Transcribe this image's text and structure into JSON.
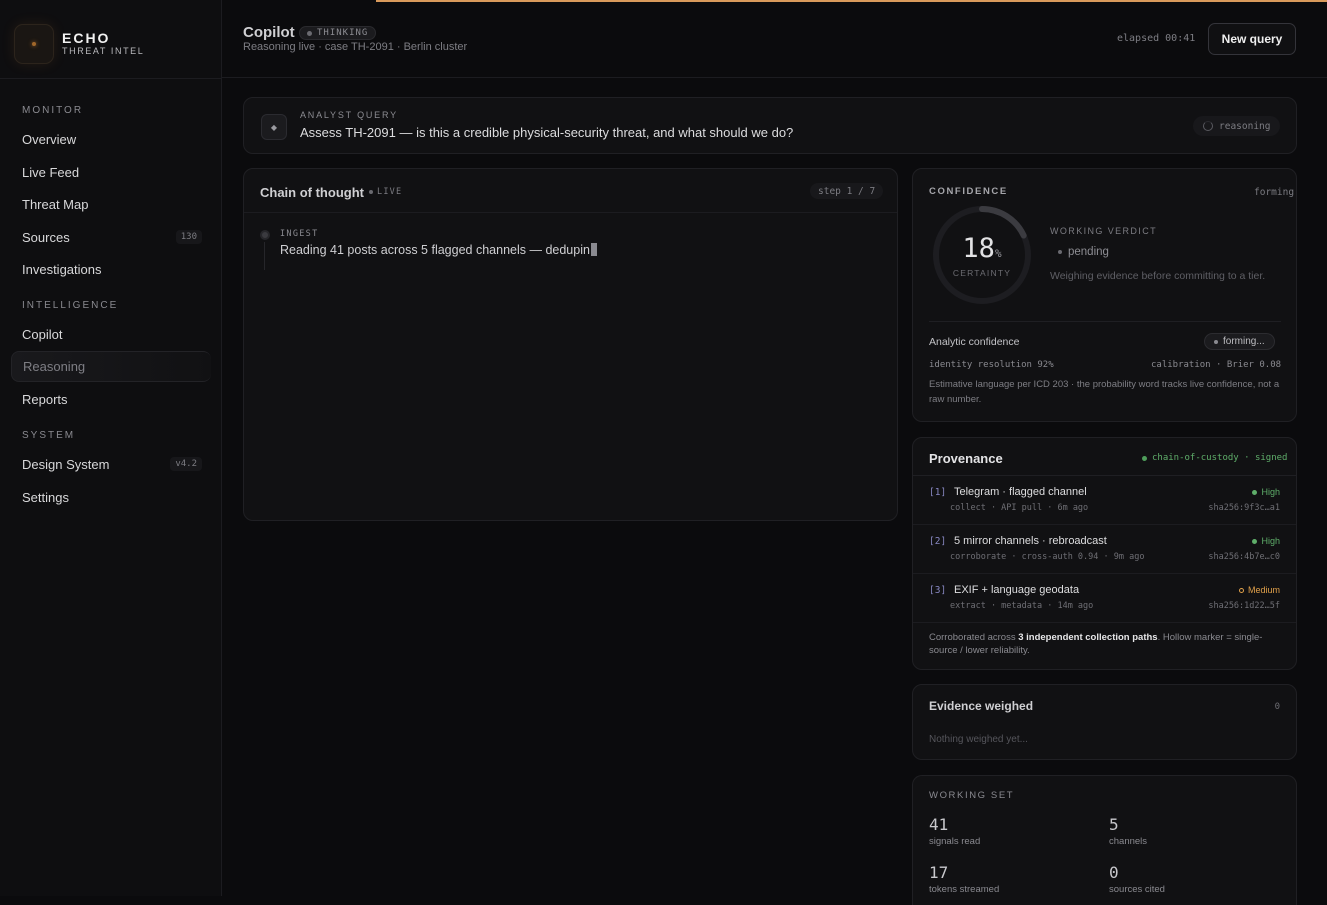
{
  "brand": {
    "name": "ECHO",
    "subtitle": "THREAT INTEL"
  },
  "sidebar": {
    "sections": [
      {
        "label": "MONITOR",
        "items": [
          {
            "label": "Overview"
          },
          {
            "label": "Live Feed"
          },
          {
            "label": "Threat Map"
          },
          {
            "label": "Sources",
            "count": "130"
          },
          {
            "label": "Investigations"
          }
        ]
      },
      {
        "label": "INTELLIGENCE",
        "items": [
          {
            "label": "Copilot"
          },
          {
            "label": "Reasoning",
            "active": true
          },
          {
            "label": "Reports"
          }
        ]
      },
      {
        "label": "SYSTEM",
        "items": [
          {
            "label": "Design System",
            "count": "v4.2"
          },
          {
            "label": "Settings"
          }
        ]
      }
    ]
  },
  "header": {
    "title": "Copilot",
    "badge": "THINKING",
    "subtitle": "Reasoning live · case TH-2091 · Berlin cluster",
    "elapsed": "elapsed 00:41",
    "new_query": "New query"
  },
  "query": {
    "label": "ANALYST QUERY",
    "text": "Assess TH-2091 — is this a credible physical-security threat, and what should we do?",
    "status": "reasoning"
  },
  "chain": {
    "title": "Chain of thought",
    "live": "LIVE",
    "step": "step 1 / 7",
    "steps": [
      {
        "label": "INGEST",
        "text": "Reading 41 posts across 5 flagged channels — dedupin"
      }
    ]
  },
  "confidence": {
    "label": "CONFIDENCE",
    "state": "forming",
    "value": 18,
    "unit": "%",
    "sublabel": "CERTAINTY",
    "verdict_label": "WORKING VERDICT",
    "verdict": "pending",
    "verdict_note": "Weighing evidence before committing to a tier.",
    "analytic_label": "Analytic confidence",
    "analytic_badge": "forming...",
    "identity": "identity resolution 92%",
    "calibration": "calibration · Brier 0.08",
    "note": "Estimative language per ICD 203 · the probability word tracks live confidence, not a raw number."
  },
  "provenance": {
    "title": "Provenance",
    "chain_of_custody": "chain-of-custody · signed",
    "sources": [
      {
        "idx": "[1]",
        "name": "Telegram · flagged channel",
        "meta": "collect · API pull · 6m ago",
        "reliability": "High",
        "hash": "sha256:9f3c…a1",
        "color": "#5fae6a",
        "hollow": false
      },
      {
        "idx": "[2]",
        "name": "5 mirror channels · rebroadcast",
        "meta": "corroborate · cross-auth 0.94 · 9m ago",
        "reliability": "High",
        "hash": "sha256:4b7e…c0",
        "color": "#5fae6a",
        "hollow": false
      },
      {
        "idx": "[3]",
        "name": "EXIF + language geodata",
        "meta": "extract · metadata · 14m ago",
        "reliability": "Medium",
        "hash": "sha256:1d22…5f",
        "color": "#e0a04a",
        "hollow": true
      }
    ],
    "footer_pre": "Corroborated across ",
    "footer_bold": "3 independent collection paths",
    "footer_post": ". Hollow marker = single-source / lower reliability."
  },
  "evidence": {
    "title": "Evidence weighed",
    "count": "0",
    "empty": "Nothing weighed yet..."
  },
  "working_set": {
    "label": "WORKING SET",
    "stats": [
      {
        "value": "41",
        "caption": "signals read"
      },
      {
        "value": "5",
        "caption": "channels"
      },
      {
        "value": "17",
        "caption": "tokens streamed"
      },
      {
        "value": "0",
        "caption": "sources cited"
      }
    ]
  },
  "colors": {
    "accent": "#d99a5b",
    "high": "#5fae6a",
    "medium": "#e0a04a",
    "index": "#8686c0"
  }
}
